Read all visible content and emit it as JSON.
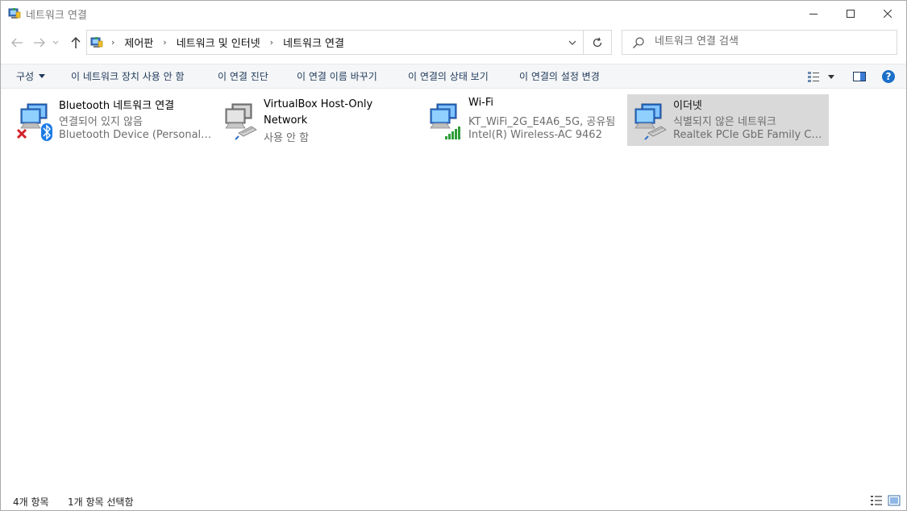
{
  "window": {
    "title": "네트워크 연결",
    "controls": {
      "minimize": "minimize",
      "maximize": "maximize",
      "close": "close"
    }
  },
  "address": {
    "breadcrumbs": [
      "제어판",
      "네트워크 및 인터넷",
      "네트워크 연결"
    ]
  },
  "search": {
    "placeholder": "네트워크 연결 검색"
  },
  "commands": {
    "organize": "구성",
    "disable": "이 네트워크 장치 사용 안 함",
    "diagnose": "이 연결 진단",
    "rename": "이 연결 이름 바꾸기",
    "status": "이 연결의 상태 보기",
    "settings": "이 연결의 설정 변경"
  },
  "connections": [
    {
      "name": "Bluetooth 네트워크 연결",
      "status": "연결되어 있지 않음",
      "device": "Bluetooth Device (Personal ...",
      "icon": "bluetooth-network-disconnected-icon"
    },
    {
      "name": "VirtualBox Host-Only Network",
      "status": "사용 안 함",
      "icon": "ethernet-adapter-disabled-icon"
    },
    {
      "name": "Wi-Fi",
      "status": "KT_WiFi_2G_E4A6_5G, 공유됨",
      "device": "Intel(R) Wireless-AC 9462",
      "icon": "wifi-signal-icon"
    },
    {
      "name": "이더넷",
      "status": "식별되지 않은 네트워크",
      "device": "Realtek PCIe GbE Family Co...",
      "icon": "ethernet-adapter-icon",
      "selected": true
    }
  ],
  "statusbar": {
    "item_count": "4개 항목",
    "selected_count": "1개 항목 선택함"
  },
  "colors": {
    "command_text": "#1e395b",
    "selection": "#d9d9d9",
    "secondary_text": "#6d6d6d",
    "help_blue": "#1a6fc9"
  }
}
